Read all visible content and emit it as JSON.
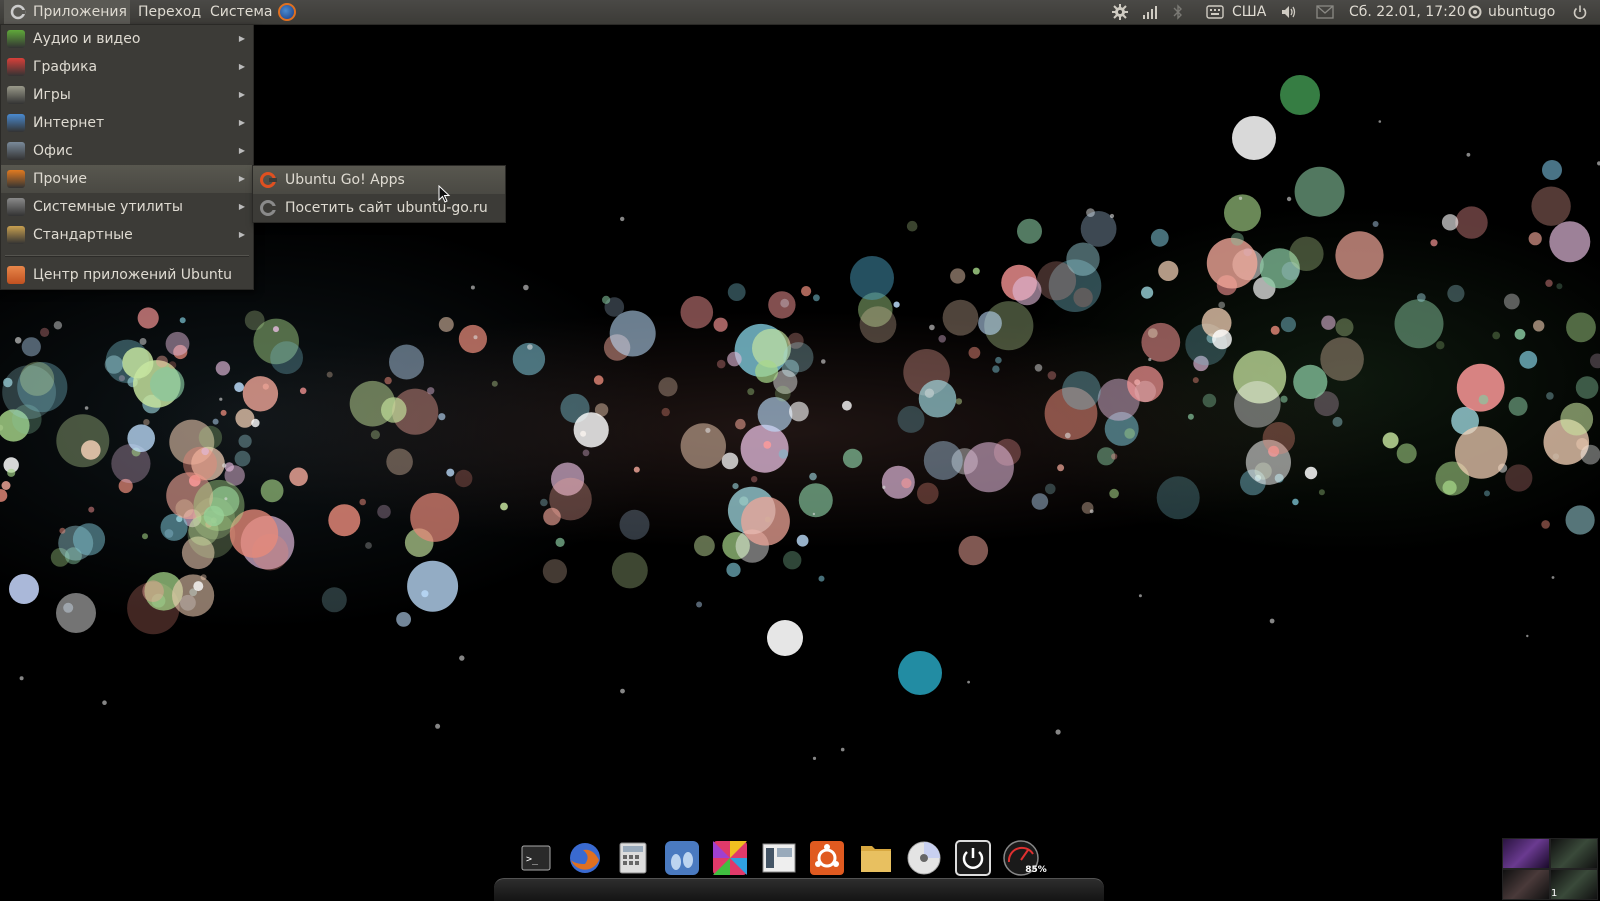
{
  "top_panel": {
    "menus": [
      "Приложения",
      "Переход",
      "Система"
    ],
    "indicators": {
      "keyboard_layout": "США",
      "datetime": "Сб. 22.01, 17:20",
      "username": "ubuntugo"
    }
  },
  "applications_menu": {
    "items": [
      {
        "label": "Аудио и видео",
        "icon": "multimedia-icon",
        "color": "#5fa83a"
      },
      {
        "label": "Графика",
        "icon": "graphics-icon",
        "color": "#d8403a"
      },
      {
        "label": "Игры",
        "icon": "games-icon",
        "color": "#9a9a8a"
      },
      {
        "label": "Интернет",
        "icon": "internet-icon",
        "color": "#4a8ad0"
      },
      {
        "label": "Офис",
        "icon": "office-icon",
        "color": "#7a8a9a"
      },
      {
        "label": "Прочие",
        "icon": "other-icon",
        "color": "#e07a20"
      },
      {
        "label": "Системные утилиты",
        "icon": "system-tools-icon",
        "color": "#8a8a8a"
      },
      {
        "label": "Стандартные",
        "icon": "accessories-icon",
        "color": "#c8a050"
      }
    ],
    "highlighted": "Прочие",
    "footer_item": {
      "label": "Центр приложений Ubuntu",
      "icon": "software-center-icon",
      "color": "#d86a30"
    }
  },
  "submenu": {
    "items": [
      {
        "label": "Ubuntu Go! Apps",
        "icon": "ubuntu-go-icon",
        "color": "#e05020"
      },
      {
        "label": "Посетить сайт ubuntu-go.ru",
        "icon": "web-link-icon",
        "color": "#8a8a8a"
      }
    ]
  },
  "dock": {
    "items": [
      {
        "name": "terminal",
        "color": "#3a3a3a"
      },
      {
        "name": "firefox",
        "color": "#e07020"
      },
      {
        "name": "calculator",
        "color": "#c8c8c8"
      },
      {
        "name": "gnome-foot",
        "color": "#3a6ab0"
      },
      {
        "name": "color-picker",
        "color": "#d04080"
      },
      {
        "name": "workspace-switcher",
        "color": "#8a9aa8"
      },
      {
        "name": "ubuntu-software",
        "color": "#e05a20"
      },
      {
        "name": "files",
        "color": "#d8a840"
      },
      {
        "name": "disc",
        "color": "#d0d0d0"
      },
      {
        "name": "shutdown",
        "color": "#1a1a1a"
      },
      {
        "name": "system-monitor",
        "color": "#2a2a2a"
      }
    ],
    "gauge_label": "85%"
  },
  "workspace_switcher": {
    "active_workspace": "1"
  },
  "colors": {
    "panel": "#3c3b37",
    "menu_bg": "#3c3b37",
    "text": "#dfdbd2",
    "ubuntu_orange": "#e05a20"
  }
}
